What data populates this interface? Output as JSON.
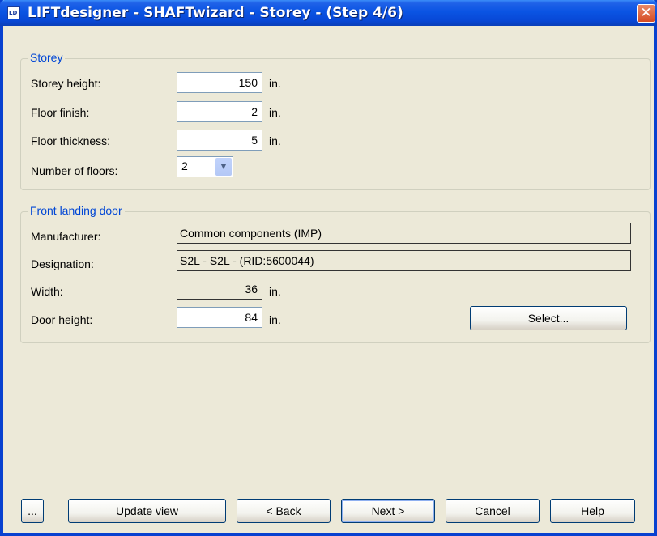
{
  "window": {
    "title": "LIFTdesigner - SHAFTwizard - Storey - (Step 4/6)",
    "app_icon_text": "LD",
    "close_glyph": "✕"
  },
  "storey": {
    "legend": "Storey",
    "storey_height": {
      "label": "Storey height:",
      "value": "150",
      "unit": "in."
    },
    "floor_finish": {
      "label": "Floor finish:",
      "value": "2",
      "unit": "in."
    },
    "floor_thickness": {
      "label": "Floor thickness:",
      "value": "5",
      "unit": "in."
    },
    "number_of_floors": {
      "label": "Number of floors:",
      "value": "2",
      "arrow_glyph": "▼"
    }
  },
  "front_landing_door": {
    "legend": "Front landing door",
    "manufacturer": {
      "label": "Manufacturer:",
      "value": "Common components (IMP)"
    },
    "designation": {
      "label": "Designation:",
      "value": "S2L - S2L - (RID:5600044)"
    },
    "width": {
      "label": "Width:",
      "value": "36",
      "unit": "in."
    },
    "door_height": {
      "label": "Door height:",
      "value": "84",
      "unit": "in."
    },
    "select_button": "Select..."
  },
  "buttons": {
    "more": "...",
    "update_view": "Update view",
    "back": "< Back",
    "next": "Next >",
    "cancel": "Cancel",
    "help": "Help"
  }
}
